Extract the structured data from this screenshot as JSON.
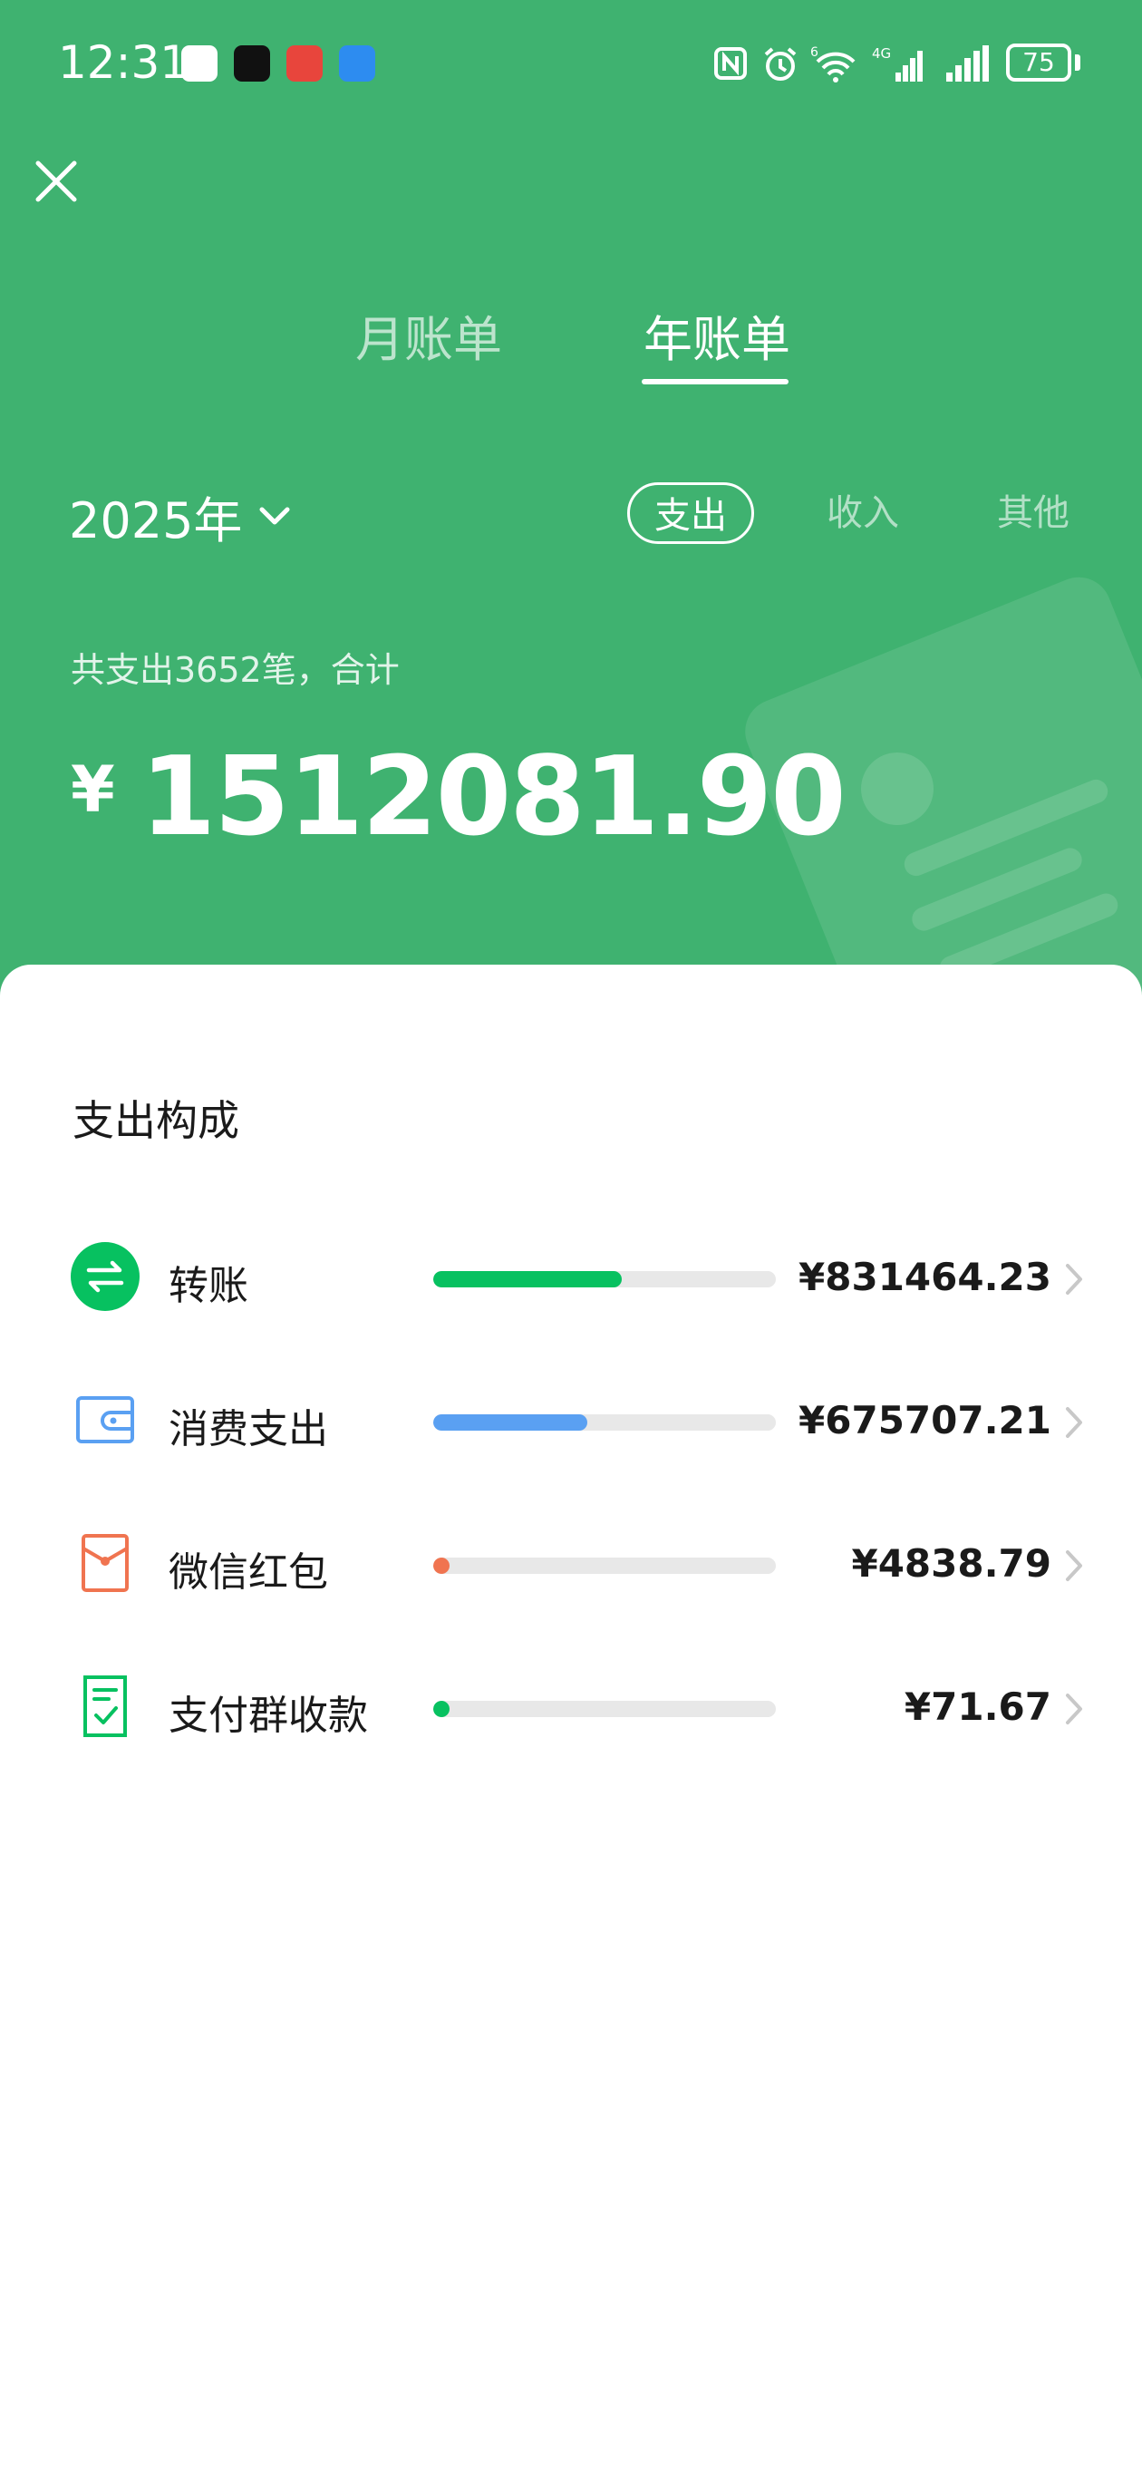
{
  "status_bar": {
    "time": "12:31",
    "battery": "75",
    "network_label": "4G",
    "wifi_label": "6"
  },
  "tabs": {
    "month": "月账单",
    "year": "年账单"
  },
  "year_selector": "2025年",
  "filters": {
    "expense": "支出",
    "income": "收入",
    "other": "其他"
  },
  "summary": {
    "text": "共支出3652笔，合计",
    "currency": "¥",
    "amount": "1512081.90"
  },
  "composition": {
    "title": "支出构成",
    "items": [
      {
        "label": "转账",
        "amount": "¥831464.23",
        "share": 0.55,
        "color": "#07c160",
        "icon": "transfer-icon"
      },
      {
        "label": "消费支出",
        "amount": "¥675707.21",
        "share": 0.45,
        "color": "#5aa0f2",
        "icon": "wallet-icon"
      },
      {
        "label": "微信红包",
        "amount": "¥4838.79",
        "share": 0.003,
        "color": "#f07450",
        "icon": "red-packet-icon"
      },
      {
        "label": "支付群收款",
        "amount": "¥71.67",
        "share": 0.0001,
        "color": "#07c160",
        "icon": "group-collect-icon"
      }
    ]
  },
  "colors": {
    "header_green": "#3fb270",
    "transfer": "#07c160",
    "consumption": "#5aa0f2",
    "red_packet": "#f07450"
  }
}
